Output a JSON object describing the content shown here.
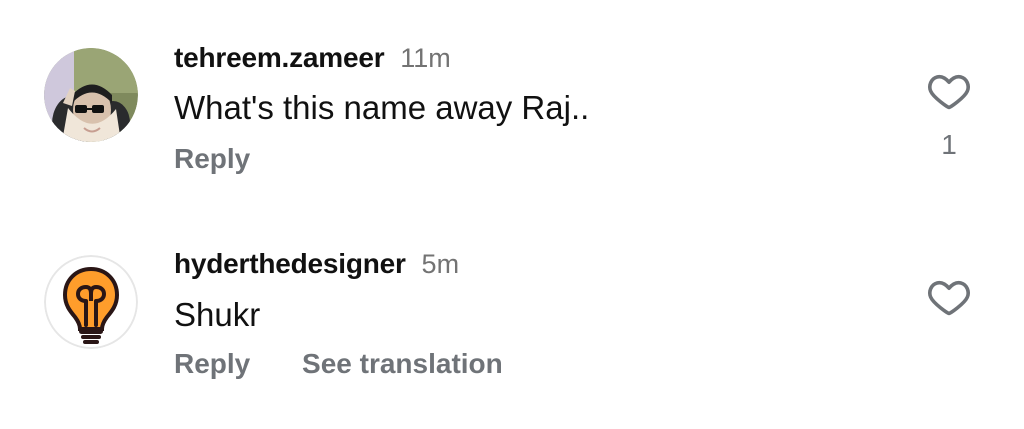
{
  "comments": [
    {
      "username": "tehreem.zameer",
      "time": "11m",
      "text": "What's this name away Raj..",
      "actions": {
        "reply": "Reply"
      },
      "likes": "1",
      "avatar": "profile-photo"
    },
    {
      "username": "hyderthedesigner",
      "time": "5m",
      "text": "Shukr",
      "actions": {
        "reply": "Reply",
        "translation": "See translation"
      },
      "avatar": "lightbulb-logo"
    }
  ],
  "colors": {
    "text_primary": "#111111",
    "text_secondary": "#6f7378",
    "time": "#737373",
    "bulb_orange": "#ff9d2b",
    "bulb_outline": "#2a1616"
  },
  "icons": {
    "like": "heart-icon"
  }
}
